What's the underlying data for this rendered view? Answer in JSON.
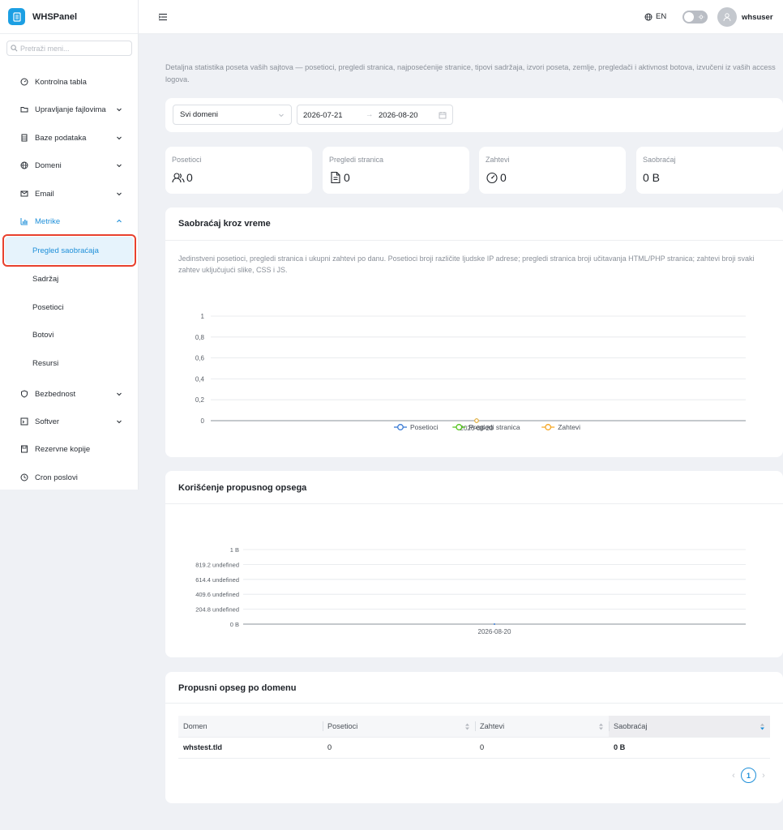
{
  "app": {
    "name": "WHSPanel"
  },
  "sidebar": {
    "search_placeholder": "Pretraži meni...",
    "items": [
      {
        "label": "Kontrolna tabla"
      },
      {
        "label": "Upravljanje fajlovima"
      },
      {
        "label": "Baze podataka"
      },
      {
        "label": "Domeni"
      },
      {
        "label": "Email"
      },
      {
        "label": "Metrike"
      },
      {
        "label": "Bezbednost"
      },
      {
        "label": "Softver"
      },
      {
        "label": "Rezervne kopije"
      },
      {
        "label": "Cron poslovi"
      }
    ],
    "metrike_sub": [
      {
        "label": "Pregled saobraćaja"
      },
      {
        "label": "Sadržaj"
      },
      {
        "label": "Posetioci"
      },
      {
        "label": "Botovi"
      },
      {
        "label": "Resursi"
      }
    ]
  },
  "topbar": {
    "language": "EN",
    "username": "whsuser"
  },
  "page": {
    "description": "Detaljna statistika poseta vaših sajtova — posetioci, pregledi stranica, najposećenije stranice, tipovi sadržaja, izvori poseta, zemlje, pregledači i aktivnost botova, izvučeni iz vaših access logova."
  },
  "filters": {
    "domain_select": "Svi domeni",
    "date_from": "2026-07-21",
    "date_to": "2026-08-20"
  },
  "stats": [
    {
      "label": "Posetioci",
      "value": "0",
      "icon": "users-icon"
    },
    {
      "label": "Pregledi stranica",
      "value": "0",
      "icon": "file-icon"
    },
    {
      "label": "Zahtevi",
      "value": "0",
      "icon": "gauge-icon"
    },
    {
      "label": "Saobraćaj",
      "value": "0 B",
      "icon": ""
    }
  ],
  "traffic_card": {
    "title": "Saobraćaj kroz vreme",
    "description": "Jedinstveni posetioci, pregledi stranica i ukupni zahtevi po danu. Posetioci broji različite ljudske IP adrese; pregledi stranica broji učitavanja HTML/PHP stranica; zahtevi broji svaki zahtev uključujući slike, CSS i JS."
  },
  "bandwidth_card": {
    "title": "Korišćenje propusnog opsega"
  },
  "domain_table": {
    "title": "Propusni opseg po domenu",
    "headers": [
      "Domen",
      "Posetioci",
      "Zahtevi",
      "Saobraćaj"
    ],
    "rows": [
      [
        "whstest.tld",
        "0",
        "0",
        "0 B"
      ]
    ],
    "page": "1"
  },
  "chart_data": [
    {
      "type": "line",
      "title": "Saobraćaj kroz vreme",
      "x": [
        "2026-08-20"
      ],
      "yticks": [
        "0",
        "0,2",
        "0,4",
        "0,6",
        "0,8",
        "1"
      ],
      "ylim": [
        0,
        1
      ],
      "legend_position": "bottom",
      "series": [
        {
          "name": "Posetioci",
          "values": [
            0
          ],
          "color": "#3a7bd5"
        },
        {
          "name": "Pregledi stranica",
          "values": [
            0
          ],
          "color": "#52c41a"
        },
        {
          "name": "Zahtevi",
          "values": [
            0
          ],
          "color": "#f5a623"
        }
      ]
    },
    {
      "type": "area",
      "title": "Korišćenje propusnog opsega",
      "x": [
        "2026-08-20"
      ],
      "yticks": [
        "0 B",
        "204.8 undefined",
        "409.6 undefined",
        "614.4 undefined",
        "819.2 undefined",
        "1 B"
      ],
      "ylim": [
        0,
        1
      ],
      "series": [
        {
          "values": [
            0
          ],
          "color": "#3a7bd5"
        }
      ]
    }
  ]
}
